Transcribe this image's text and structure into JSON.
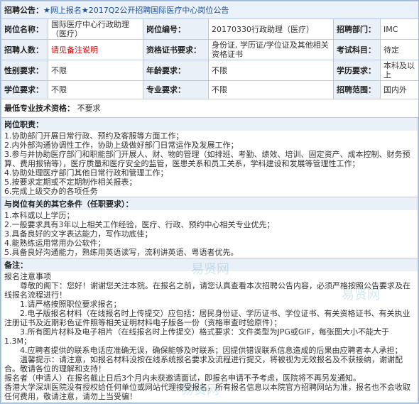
{
  "header": {
    "label": "招聘公告：",
    "title": "★网上报名★2017Q2公开招聘国际医疗中心岗位公告"
  },
  "info": {
    "position_name_label": "岗位名称：",
    "position_name": "国际医疗中心行政助理（医疗）",
    "position_code_label": "岗位编号：",
    "position_code": "20170330行政助理（医疗）",
    "dept_label": "招聘部门：",
    "dept": "IMC",
    "count_label": "招聘人数：",
    "count": "请见备注说明",
    "cert_label": "资格证书要求：",
    "cert": "身份证, 学历证/学位证及其他相关资格证书",
    "exam_label": "考试科目：",
    "exam": "待定",
    "gender_label": "性别要求：",
    "gender": "不限",
    "age_label": "年龄要求：",
    "age": "不限",
    "edu_label": "学历要求：",
    "edu": "本科及以上",
    "degree_label": "学位要求：",
    "degree": "不限",
    "major_label": "专业要求：",
    "major": "不限",
    "scope_label": "招聘范围：",
    "scope": "国内外",
    "tech_label": "最低专业技术资格：",
    "tech": "不要求"
  },
  "duties": {
    "heading": "岗位职责：",
    "lines": [
      "1.协助部门开展日常行政、预约及客服等方面工作；",
      "2.内外部沟通协调性工作，协助上级做好部门日常运作及发展工作；",
      "3.参与并协助医疗部门和职能部门开展人、财、物的管理（如排班、考勤、绩效、培训、固定资产、成本控制、财务预算、费用报销等），医疗质量和医疗安全的监管，医患关系和员工关系，学科建设和发展等管理性工作；",
      "4.协助处理医疗部门其他日常行政和管理工作；",
      "5.按要求定期或不定期制作相关报表；",
      "6.完成上级交办的各项任务"
    ]
  },
  "other": {
    "heading": "与岗位有关的其它条件（任职要求）：",
    "lines": [
      "1.本科或以上学历；",
      "2.一般要求具有3年以上相关工作经验，医疗、行政、预约中心相关专业优先；",
      "3.具备良好的文字表达能力，写作功底佳；",
      "4.能熟练运用常用办公软件；",
      "5.具备良好沟通能力，熟练用英语读写，流利讲英语、粤语者优先。"
    ]
  },
  "remarks": {
    "heading": "备注：",
    "lines": [
      "报名注意事项",
      "　　尊敬的阁下：您好！谢谢您关注本院。在报名之前，请您认真查看本次招聘公告内容，必须严格按照公告要求及在线报名流程进行！",
      "　　1.请严格按照职位要求报名；",
      "　　2.电子版报名材料（在线报名时上传提交）应包括：居民身份证、学历证书、学位证书、有关资格证书、有关执业注册证书及近期彩色证件照等相关证明材料电子版各一份（资格审查时验原件）；",
      "　　3.所有图片材料及电子相片（在线报名时上传提交）格式要求：文件类型为JPG或GIF，每张图大小不能大于1.3M；",
      "　　4.应聘者提供的联系电话应准确无误，确保能够及时联系；因提供错误联系信息造成的后果由应聘者本人承担；",
      "　　温馨提示：请注意，如报名材料没按在线系统报名要求及流程进行提交，将被视为无效报名及不获接纳，谢谢配合。敬请各位的理解和支持！",
      "报名者（申请人）在报名截止日后3个月内未获邀请面试，即报名申请不予考虑，医院将不再另发通知。",
      "香港大学深圳医院没有授权给任何单位或网站代理接受报名，所有报名信息以本院官方招聘网站为准，报名也不会收取任何费用，敬请注意，请勿上当受骗！"
    ]
  },
  "watermarks": [
    "易贤网",
    "易贤网",
    "易贤网"
  ]
}
